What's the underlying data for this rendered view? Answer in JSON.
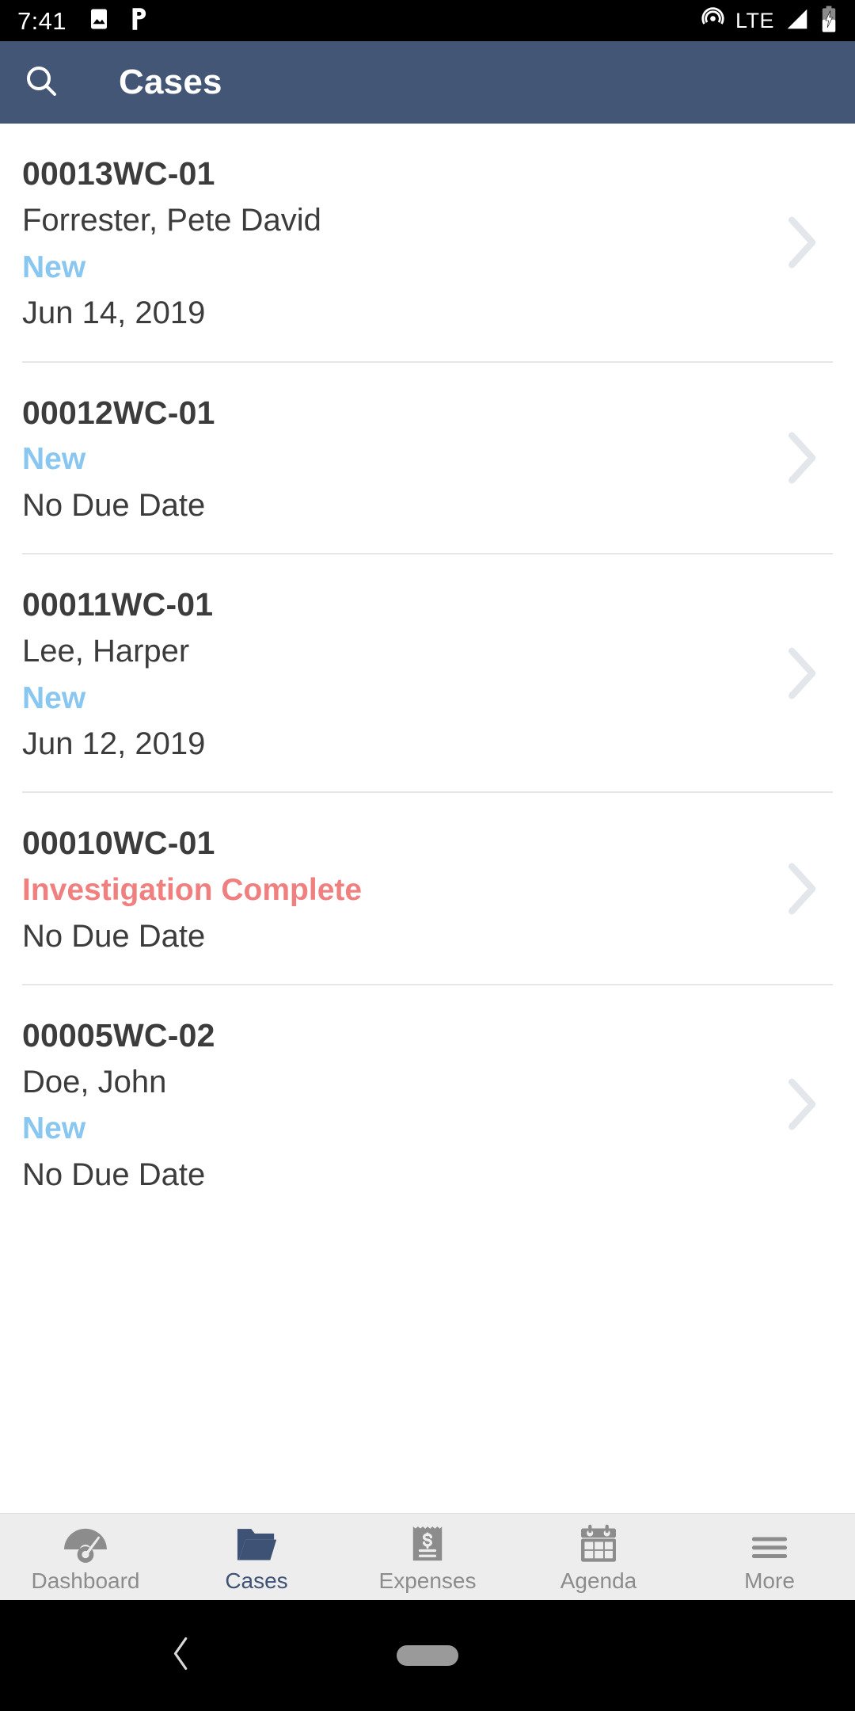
{
  "status_bar": {
    "clock": "7:41",
    "network_label": "LTE",
    "icons": [
      "image-icon",
      "pandora-p-icon",
      "hotspot-icon",
      "signal-icon",
      "battery-charging-icon"
    ]
  },
  "app_bar": {
    "title": "Cases",
    "search_icon": "search-icon",
    "background": "#445675"
  },
  "colors": {
    "accent_blue": "#3d5275",
    "status_new": "#89c6f0",
    "status_investigation": "#f08080",
    "chevron": "#e3e7ec",
    "text": "#3c3c3c"
  },
  "cases": [
    {
      "id": "00013WC-01",
      "name": "Forrester, Pete David",
      "status": "New",
      "status_kind": "new",
      "due": "Jun 14, 2019"
    },
    {
      "id": "00012WC-01",
      "name": "",
      "status": "New",
      "status_kind": "new",
      "due": "No Due Date"
    },
    {
      "id": "00011WC-01",
      "name": "Lee, Harper",
      "status": "New",
      "status_kind": "new",
      "due": "Jun 12, 2019"
    },
    {
      "id": "00010WC-01",
      "name": "",
      "status": "Investigation Complete",
      "status_kind": "investigation",
      "due": "No Due Date"
    },
    {
      "id": "00005WC-02",
      "name": "Doe, John",
      "status": "New",
      "status_kind": "new",
      "due": "No Due Date"
    }
  ],
  "tabs": [
    {
      "label": "Dashboard",
      "icon": "gauge-icon",
      "active": false
    },
    {
      "label": "Cases",
      "icon": "folder-icon",
      "active": true
    },
    {
      "label": "Expenses",
      "icon": "receipt-icon",
      "active": false
    },
    {
      "label": "Agenda",
      "icon": "calendar-icon",
      "active": false
    },
    {
      "label": "More",
      "icon": "hamburger-icon",
      "active": false
    }
  ],
  "nav_bar": {
    "back_icon": "back-chevron-icon",
    "home_icon": "home-pill-icon"
  }
}
